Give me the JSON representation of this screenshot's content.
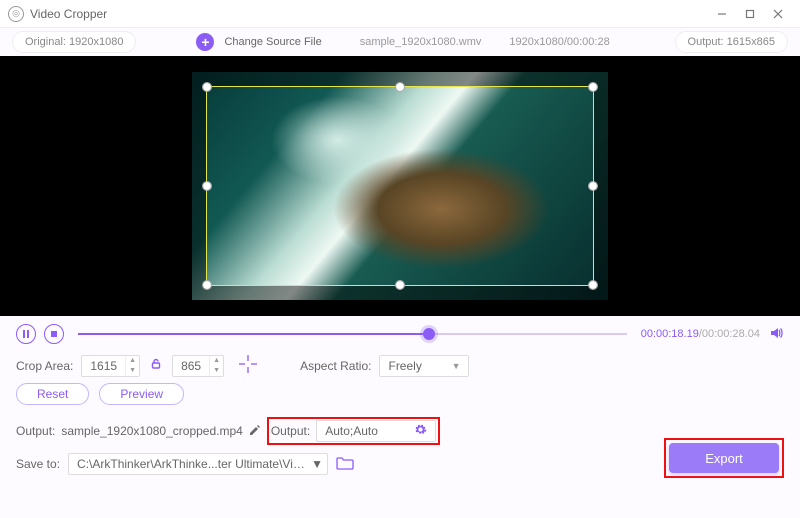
{
  "app": {
    "title": "Video Cropper"
  },
  "header": {
    "original_label": "Original: 1920x1080",
    "change_source": "Change Source File",
    "filename": "sample_1920x1080.wmv",
    "resolution_duration": "1920x1080/00:00:28",
    "output_label": "Output: 1615x865"
  },
  "playback": {
    "current_time": "00:00:18.19",
    "total_time": "/00:00:28.04"
  },
  "crop": {
    "area_label": "Crop Area:",
    "width": "1615",
    "height": "865",
    "aspect_label": "Aspect Ratio:",
    "aspect_value": "Freely"
  },
  "buttons": {
    "reset": "Reset",
    "preview": "Preview",
    "export": "Export"
  },
  "output": {
    "label": "Output:",
    "filename": "sample_1920x1080_cropped.mp4",
    "fmt_label": "Output:",
    "fmt_value": "Auto;Auto"
  },
  "save": {
    "label": "Save to:",
    "path": "C:\\ArkThinker\\ArkThinke...ter Ultimate\\Video Crop"
  }
}
